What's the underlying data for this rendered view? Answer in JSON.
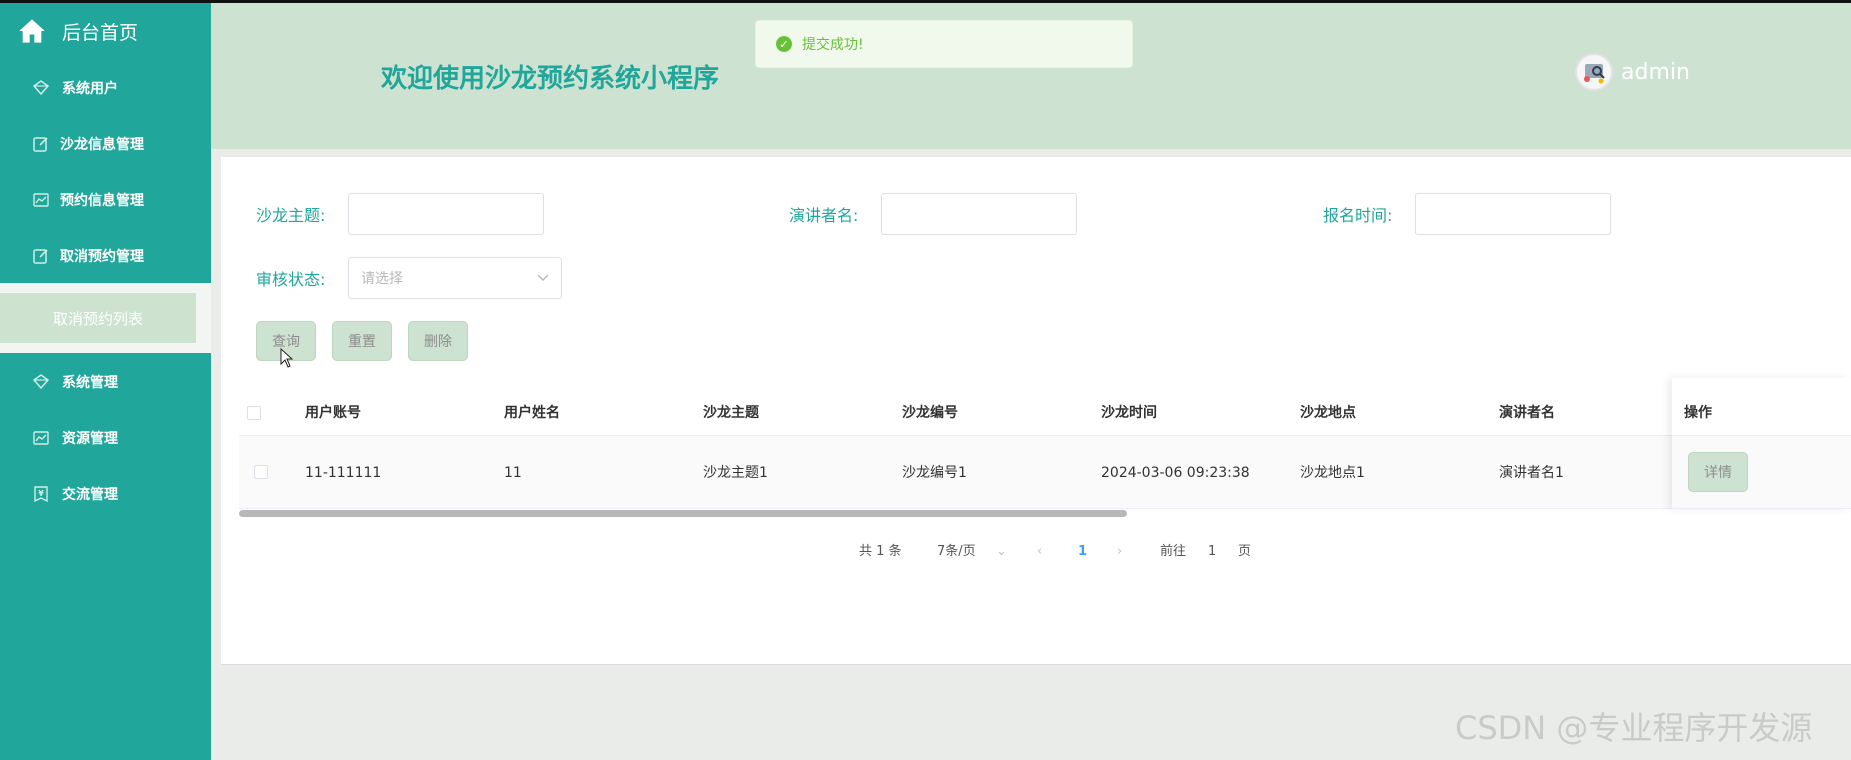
{
  "sidebar": {
    "brand": "后台首页",
    "items": [
      {
        "label": "系统用户",
        "icon": "diamond-icon"
      },
      {
        "label": "沙龙信息管理",
        "icon": "edit-icon"
      },
      {
        "label": "预约信息管理",
        "icon": "chart-icon"
      },
      {
        "label": "取消预约管理",
        "icon": "edit-icon"
      }
    ],
    "active_sub": "取消预约列表",
    "items_after": [
      {
        "label": "系统管理",
        "icon": "diamond-icon"
      },
      {
        "label": "资源管理",
        "icon": "chart-icon"
      },
      {
        "label": "交流管理",
        "icon": "yen-icon"
      }
    ]
  },
  "header": {
    "title": "欢迎使用沙龙预约系统小程序",
    "username": "admin"
  },
  "toast": {
    "message": "提交成功!",
    "color": "#67c23a"
  },
  "search": {
    "topic_label": "沙龙主题:",
    "topic_value": "",
    "speaker_label": "演讲者名:",
    "speaker_value": "",
    "signup_label": "报名时间:",
    "signup_value": "",
    "status_label": "审核状态:",
    "status_placeholder": "请选择"
  },
  "buttons": {
    "query": "查询",
    "reset": "重置",
    "delete": "删除"
  },
  "table": {
    "columns": [
      "用户账号",
      "用户姓名",
      "沙龙主题",
      "沙龙编号",
      "沙龙时间",
      "沙龙地点",
      "演讲者名",
      "操作"
    ],
    "rows": [
      {
        "account": "11-111111",
        "name": "11",
        "topic": "沙龙主题1",
        "number": "沙龙编号1",
        "time": "2024-03-06 09:23:38",
        "place": "沙龙地点1",
        "speaker": "演讲者名1",
        "action": "详情"
      }
    ]
  },
  "pagination": {
    "total": "共 1 条",
    "page_size": "7条/页",
    "current_page": "1",
    "goto_label": "前往",
    "goto_value": "1",
    "page_suffix": "页"
  },
  "watermark": "CSDN @专业程序开发源",
  "colors": {
    "sidebar": "#20a69a",
    "header": "#cde2d0",
    "accent": "#20a69a",
    "button": "#cde2d0"
  }
}
